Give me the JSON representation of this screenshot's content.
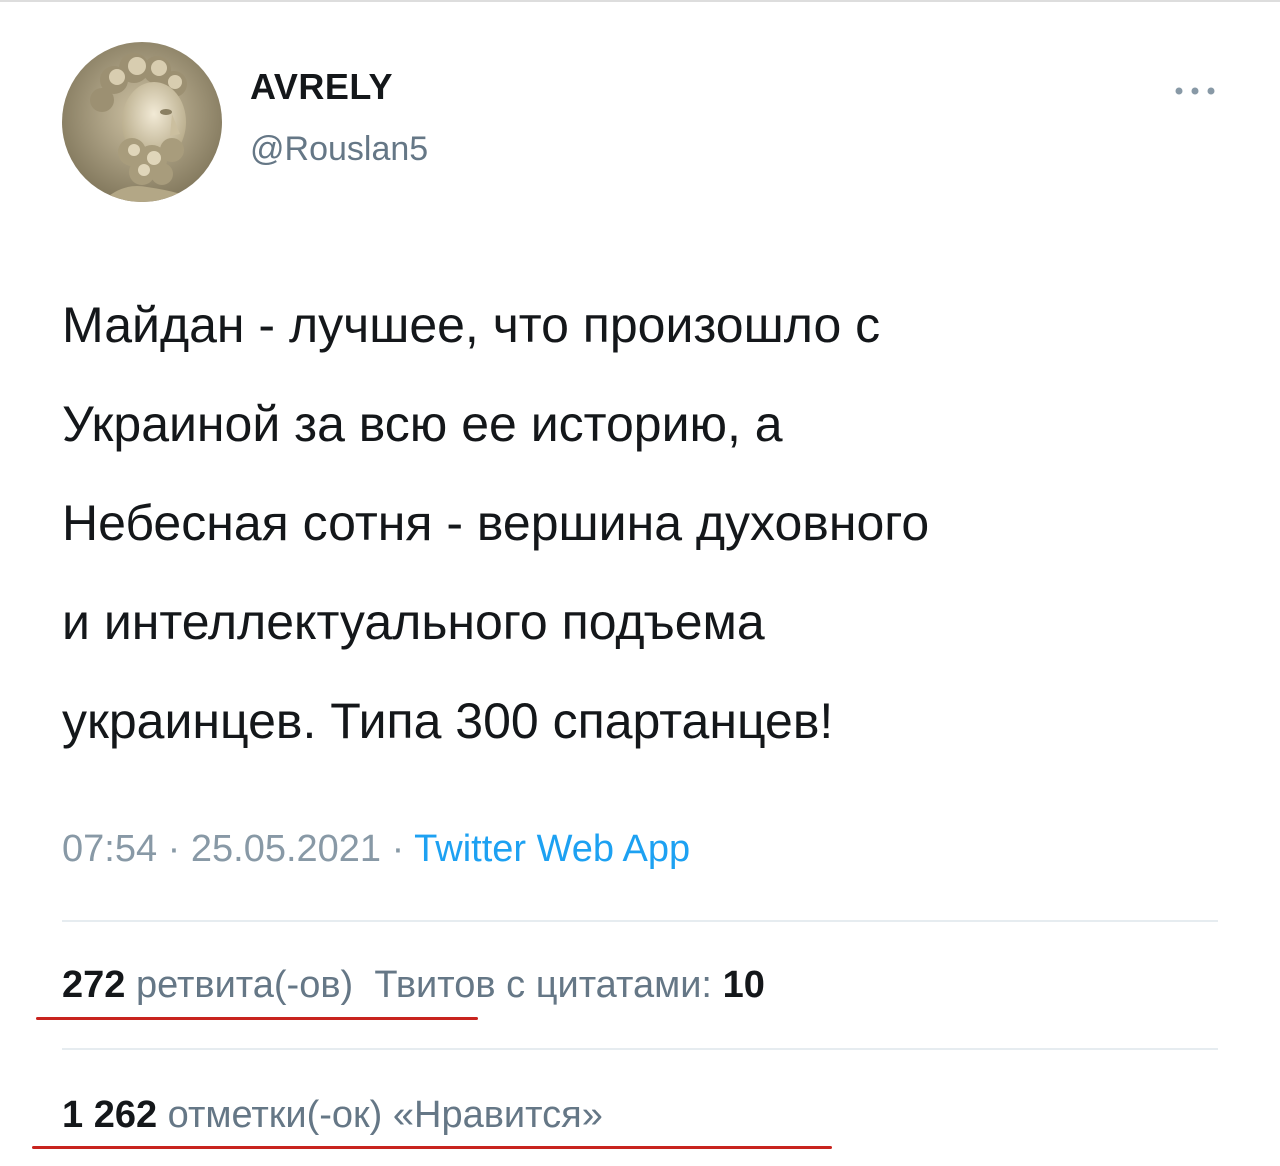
{
  "tweet": {
    "author": {
      "display_name": "AVRELY",
      "handle": "@Rouslan5",
      "avatar_icon": "marble-bust-avatar"
    },
    "more_icon": "more-dots-icon",
    "text": "Майдан - лучшее, что произошло с\nУкраиной за всю ее историю, а\nНебесная сотня - вершина духовного\nи интеллектуального подъема\nукраинцев. Типа 300 спартанцев!",
    "time": "07:54",
    "separator": " · ",
    "date": "25.05.2021",
    "source": "Twitter Web App"
  },
  "stats": {
    "retweets": {
      "count": "272",
      "label": "ретвита(-ов)"
    },
    "quotes": {
      "label": "Твитов с цитатами:",
      "count": "10"
    },
    "likes": {
      "count": "1 262",
      "label": "отметки(-ок) «Нравится»"
    }
  },
  "colors": {
    "text": "#14171a",
    "secondary": "#657786",
    "meta": "#8899a6",
    "link": "#1da1f2",
    "divider": "#e6ecf0",
    "annotation_underline": "#c8231e"
  }
}
